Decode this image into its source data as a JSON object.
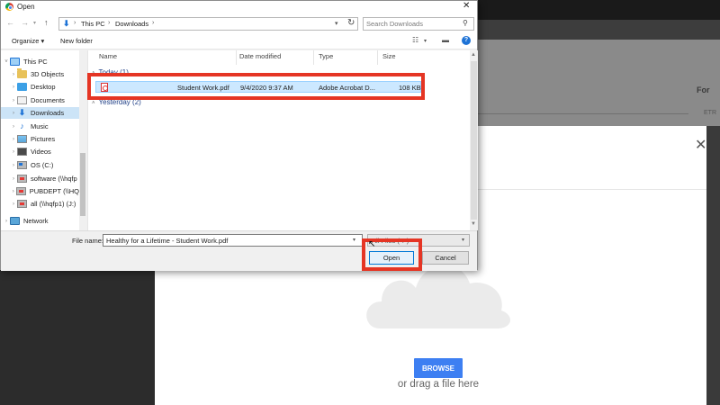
{
  "dialog": {
    "title": "Open",
    "close": "✕"
  },
  "nav": {
    "back": "←",
    "forward": "→",
    "up": "↑",
    "breadcrumb": [
      "This PC",
      "Downloads"
    ],
    "refresh": "↻",
    "search_placeholder": "Search Downloads"
  },
  "toolbar": {
    "organize": "Organize ▾",
    "new_folder": "New folder",
    "help": "?"
  },
  "sidebar": {
    "items": [
      {
        "label": "This PC",
        "icon": "computer-icon"
      },
      {
        "label": "3D Objects",
        "icon": "folder-icon"
      },
      {
        "label": "Desktop",
        "icon": "desktop-icon"
      },
      {
        "label": "Documents",
        "icon": "documents-icon"
      },
      {
        "label": "Downloads",
        "icon": "downloads-icon",
        "selected": true
      },
      {
        "label": "Music",
        "icon": "music-icon"
      },
      {
        "label": "Pictures",
        "icon": "pictures-icon"
      },
      {
        "label": "Videos",
        "icon": "videos-icon"
      },
      {
        "label": "OS (C:)",
        "icon": "drive-icon"
      },
      {
        "label": "software (\\\\hqfp",
        "icon": "network-drive-icon"
      },
      {
        "label": "PUBDEPT (\\\\HQ",
        "icon": "network-drive-icon"
      },
      {
        "label": "all (\\\\hqfp1) (J:)",
        "icon": "network-drive-icon"
      },
      {
        "label": "Network",
        "icon": "network-icon"
      }
    ]
  },
  "columns": [
    "Name",
    "Date modified",
    "Type",
    "Size"
  ],
  "groups": {
    "today": "Today (1)",
    "yesterday": "Yesterday (2)"
  },
  "file": {
    "name": "Student Work.pdf",
    "date": "9/4/2020 9:37 AM",
    "type": "Adobe Acrobat D...",
    "size": "108 KB"
  },
  "bottom": {
    "file_name_label": "File name:",
    "file_name_value": "Healthy for a Lifetime - Student Work.pdf",
    "file_type_value": "All Files (*.*)",
    "open": "Open",
    "cancel": "Cancel"
  },
  "background": {
    "for_text": "For",
    "etr_text": "ETR",
    "modal_close": "✕",
    "browse": "BROWSE",
    "drag_text": "or drag a file here"
  },
  "colors": {
    "highlight": "#e53524",
    "browse_button": "#3d7ff2",
    "selection": "#cce8ff"
  }
}
